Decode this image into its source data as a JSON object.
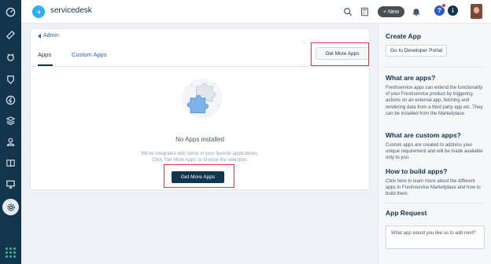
{
  "app": {
    "name": "servicedesk"
  },
  "topbar": {
    "new_label": "+ New",
    "help_glyph": "?",
    "info_glyph": "i"
  },
  "sidebar": {
    "icons": [
      "dashboard-icon",
      "tickets-icon",
      "problems-icon",
      "changes-icon",
      "releases-icon",
      "assets-icon",
      "contacts-icon",
      "solutions-icon",
      "reports-icon",
      "settings-icon",
      "app-switcher-icon"
    ]
  },
  "main": {
    "breadcrumb": "Admin",
    "tabs": [
      {
        "label": "Apps",
        "active": true
      },
      {
        "label": "Custom Apps",
        "active": false
      }
    ],
    "get_more_apps_top": "Get More Apps",
    "empty": {
      "title": "No Apps installed",
      "desc_line1": "We've integrated with some of your favorite applications.",
      "desc_line2": "Click 'Get More Apps' to browse the selection.",
      "button": "Get More Apps"
    }
  },
  "right_panel": {
    "create_app": {
      "title": "Create App",
      "button": "Go to Developer Portal"
    },
    "what_are_apps": {
      "title": "What are apps?",
      "text": "Freshservice apps can extend the functionality of your Freshservice product by triggering actions on an external app, fetching and rendering data from a third party app etc. They can be installed from the Marketplace."
    },
    "custom_apps": {
      "title": "What are custom apps?",
      "text": "Custom apps are created to address your unique requirement and will be made available only to you."
    },
    "build_apps": {
      "title": "How to build apps?",
      "text_before": "Click ",
      "link": "here",
      "text_after": " to learn more about the different apps in Freshservice Marketplace and how to build them."
    },
    "app_request": {
      "title": "App Request",
      "placeholder": "What app would you like us to add next?"
    }
  },
  "colors": {
    "sidebar_bg": "#12344d",
    "primary_button": "#12344d",
    "link": "#2c5cc5",
    "highlight": "#e53935",
    "logo": "#2daefb"
  }
}
